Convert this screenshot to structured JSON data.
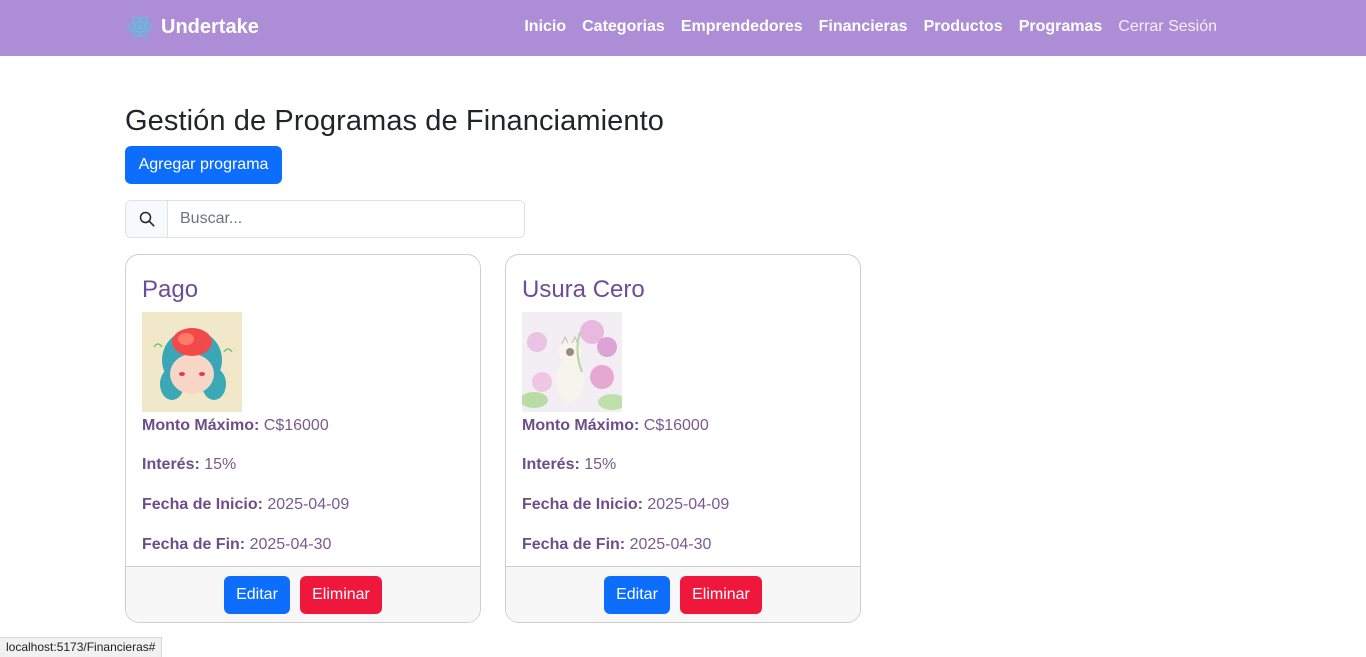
{
  "navbar": {
    "brand": "Undertake",
    "brand_icon": "react-atom-icon",
    "links": [
      "Inicio",
      "Categorias",
      "Emprendedores",
      "Financieras",
      "Productos",
      "Programas",
      "Cerrar Sesión"
    ],
    "background": "#ad8dd6"
  },
  "main": {
    "title": "Gestión de Programas de Financiamiento",
    "add_button": "Agregar programa",
    "search": {
      "placeholder": "Buscar...",
      "value": "",
      "icon": "search-icon"
    }
  },
  "labels": {
    "monto": "Monto Máximo:",
    "interes": "Interés:",
    "inicio": "Fecha de Inicio:",
    "fin": "Fecha de Fin:",
    "edit": "Editar",
    "delete": "Eliminar"
  },
  "programs": [
    {
      "name": "Pago",
      "monto": "C$16000",
      "interes": "15%",
      "inicio": "2025-04-09",
      "fin": "2025-04-30",
      "image": "illustrated-girl-portrait"
    },
    {
      "name": "Usura Cero",
      "monto": "C$16000",
      "interes": "15%",
      "inicio": "2025-04-09",
      "fin": "2025-04-30",
      "image": "white-cat-with-flowers"
    }
  ],
  "status_url": "localhost:5173/Financieras#",
  "colors": {
    "primary": "#0d6efd",
    "danger": "#f0173d",
    "accent": "#6b4e9b"
  }
}
